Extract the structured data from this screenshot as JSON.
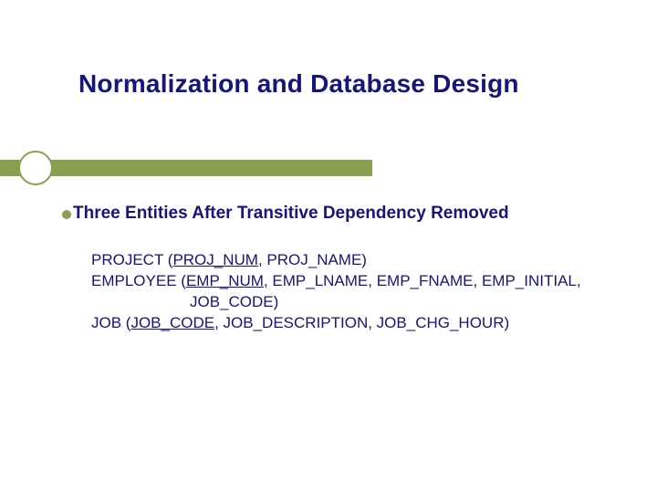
{
  "title": "Normalization and Database Design",
  "bullet": "Three Entities After Transitive Dependency Removed",
  "entities": {
    "project": {
      "name": "PROJECT",
      "pk": "PROJ_NUM",
      "rest": ", PROJ_NAME)"
    },
    "employee": {
      "name": "EMPLOYEE",
      "pk": "EMP_NUM",
      "rest1": ", EMP_LNAME, EMP_FNAME, EMP_INITIAL,",
      "rest2": "JOB_CODE)"
    },
    "job": {
      "name": "JOB",
      "pk": "JOB_CODE",
      "rest": ", JOB_DESCRIPTION, JOB_CHG_HOUR)"
    }
  }
}
